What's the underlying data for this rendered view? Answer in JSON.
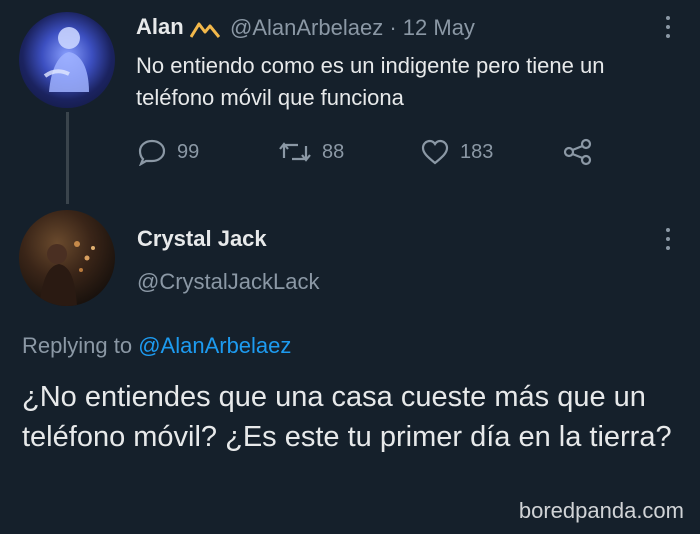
{
  "original_tweet": {
    "display_name": "Alan",
    "handle": "@AlanArbelaez",
    "separator": "·",
    "date": "12 May",
    "text": "No entiendo como es un indigente pero tiene un teléfono móvil que funciona",
    "actions": {
      "replies": "99",
      "retweets": "88",
      "likes": "183"
    }
  },
  "reply_tweet": {
    "display_name": "Crystal Jack",
    "handle": "@CrystalJackLack",
    "replying_prefix": "Replying to",
    "replying_to": "@AlanArbelaez",
    "text": "¿No entiendes que una casa cueste más que un teléfono móvil? ¿Es este tu primer día en la tierra?"
  },
  "watermark": "boredpanda.com",
  "icons": {
    "reply": "speech-bubble-icon",
    "retweet": "retweet-arrows-icon",
    "like": "heart-icon",
    "share": "share-icon",
    "more": "vertical-dots-icon",
    "name_emoji": "mountain-emoji-icon"
  },
  "colors": {
    "background": "#15202b",
    "text": "#e7e9ea",
    "muted": "#8b98a5",
    "link": "#1d9bf0"
  }
}
